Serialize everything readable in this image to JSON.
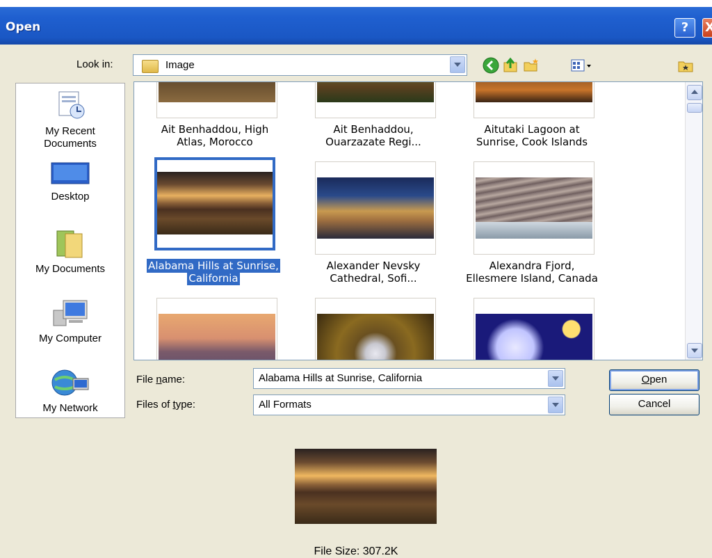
{
  "window": {
    "title": "Open",
    "help_label": "?",
    "close_label": "X"
  },
  "toolbar": {
    "look_in_label": "Look in:",
    "look_in_value": "Image",
    "icons": [
      "back-icon",
      "up-folder-icon",
      "new-folder-icon",
      "views-menu-icon",
      "desktop-folder-icon"
    ]
  },
  "places": [
    {
      "label1": "My Recent",
      "label2": "Documents",
      "icon": "recent-documents-icon"
    },
    {
      "label1": "Desktop",
      "label2": "",
      "icon": "desktop-icon"
    },
    {
      "label1": "My Documents",
      "label2": "",
      "icon": "my-documents-icon"
    },
    {
      "label1": "My Computer",
      "label2": "",
      "icon": "my-computer-icon"
    },
    {
      "label1": "My Network",
      "label2": "",
      "icon": "my-network-icon"
    }
  ],
  "files": [
    {
      "line1": "Ait Benhaddou, High",
      "line2": "Atlas, Morocco",
      "selected": false
    },
    {
      "line1": "Ait Benhaddou,",
      "line2": "Ouarzazate Regi...",
      "selected": false
    },
    {
      "line1": "Aitutaki Lagoon at",
      "line2": "Sunrise, Cook Islands",
      "selected": false
    },
    {
      "line1": "Alabama Hills at Sunrise,",
      "line2": "California",
      "selected": true
    },
    {
      "line1": "Alexander Nevsky",
      "line2": "Cathedral, Sofi...",
      "selected": false
    },
    {
      "line1": "Alexandra Fjord,",
      "line2": "Ellesmere Island, Canada",
      "selected": false
    },
    {
      "line1": "",
      "line2": "",
      "selected": false
    },
    {
      "line1": "",
      "line2": "",
      "selected": false
    },
    {
      "line1": "",
      "line2": "",
      "selected": false
    }
  ],
  "form": {
    "file_name_label_pre": "File ",
    "file_name_label_key": "n",
    "file_name_label_post": "ame:",
    "file_name_value": "Alabama Hills at Sunrise, California",
    "file_type_label_pre": "Files of ",
    "file_type_label_key": "t",
    "file_type_label_post": "ype:",
    "file_type_value": "All Formats"
  },
  "buttons": {
    "open_key": "O",
    "open_rest": "pen",
    "cancel": "Cancel"
  },
  "preview": {
    "file_size": "File Size: 307.2K"
  },
  "colors": {
    "selection": "#316ac5",
    "titlebar": "#1f5fcf"
  }
}
